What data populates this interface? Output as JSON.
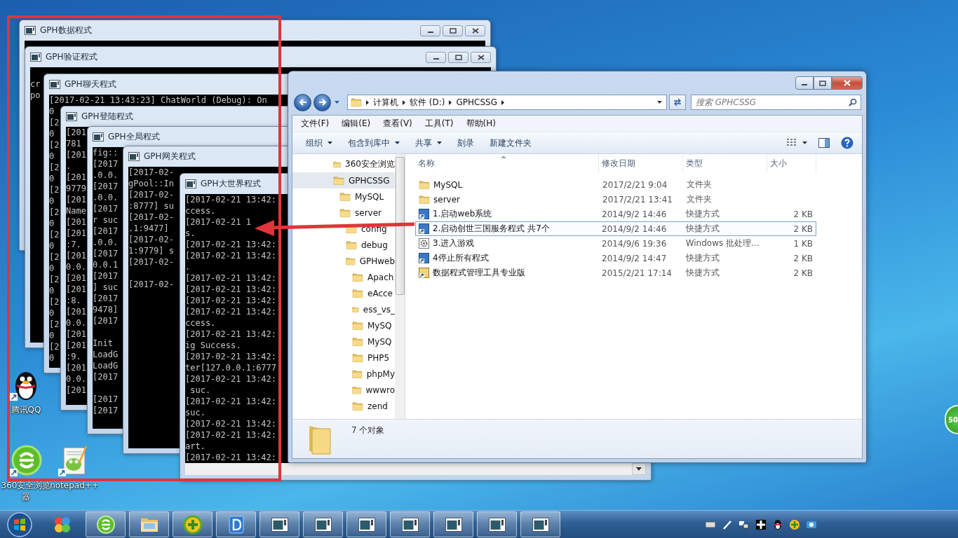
{
  "consoles": [
    {
      "title": "GPH数据程式"
    },
    {
      "title": "GPH验证程式",
      "blocks": [
        [
          "cr",
          "po"
        ]
      ]
    },
    {
      "title": "GPH聊天程式",
      "blocks": [
        [
          "[2017-02-21 13:43:23] ChatWorld (Debug): On",
          "0",
          "[2",
          "0",
          "[2",
          "0",
          "[2",
          "0",
          "[2",
          "0",
          "[2",
          "0",
          "[2",
          "0",
          "[2",
          "0",
          "[2",
          "0",
          "[2",
          "0",
          "[2",
          "0",
          "[2",
          "0"
        ]
      ]
    },
    {
      "title": "GPH登陆程式",
      "blocks": [
        [
          "[201",
          "781",
          "[201",
          ".",
          "[201",
          "9779",
          "[201",
          "Name",
          "[201",
          "[201",
          ":7.",
          "[201",
          "0.0.",
          "[201",
          "[201",
          ":8.",
          "[201",
          "0.0.",
          "[201",
          "[201",
          ":9.",
          "[201",
          "0.0.",
          "[201"
        ]
      ]
    },
    {
      "title": "GPH全局程式",
      "blocks": [
        [
          "fig::",
          "[2017",
          ".0.0.",
          "[2017",
          ".0.0.",
          "[2017",
          "r suc",
          "[2017",
          ".0.0.",
          "[2017",
          "0.0.1",
          "[2017",
          "] suc",
          "[2017",
          "9478]",
          "[2017"
        ],
        [
          "Init",
          "LoadG",
          "LoadG",
          "[2017"
        ],
        [
          "[2017",
          "[2017"
        ]
      ]
    },
    {
      "title": "GPH网关程式",
      "blocks": [
        [
          "[2017-02-",
          "gPool::In",
          "[2017-02-",
          ":8777] su",
          "[2017-02-",
          ".1:9477]",
          "[2017-02-",
          "1:9779] s",
          "[2017-02-"
        ],
        [
          "[2017-02-"
        ]
      ]
    },
    {
      "title": "GPH大世界程式",
      "blocks": [
        [
          "[2017-02-21 13:42:",
          "ccess.",
          "[2017-02-21 1",
          "s.",
          "[2017-02-21 13:42:",
          "[2017-02-21 13:42:",
          ".",
          "[2017-02-21 13:42:",
          "[2017-02-21 13:42:",
          "[2017-02-21 13:42:",
          "[2017-02-21 13:42:",
          "ccess.",
          "[2017-02-21 13:42:",
          "ig Success.",
          "[2017-02-21 13:42:",
          "ter[127.0.0.1:6777",
          "[2017-02-21 13:42:",
          " suc.",
          "[2017-02-21 13:42:",
          "suc.",
          "[2017-02-21 13:42:",
          "[2017-02-21 13:42:",
          "art.",
          "[2017-02-21 13:42:"
        ]
      ]
    }
  ],
  "explorer": {
    "breadcrumb": [
      "计算机",
      "软件 (D:)",
      "GPHCSSG"
    ],
    "search": {
      "placeholder": "搜索 GPHCSSG"
    },
    "menu": [
      "文件(F)",
      "编辑(E)",
      "查看(V)",
      "工具(T)",
      "帮助(H)"
    ],
    "toolbar": [
      {
        "label": "组织",
        "dropdown": true
      },
      {
        "label": "包含到库中",
        "dropdown": true
      },
      {
        "label": "共享",
        "dropdown": true
      },
      {
        "label": "刻录",
        "dropdown": false
      },
      {
        "label": "新建文件夹",
        "dropdown": false
      }
    ],
    "tree": [
      {
        "label": "360安全浏览",
        "selected": false
      },
      {
        "label": "GPHCSSG",
        "selected": true,
        "children": [
          {
            "label": "MySQL",
            "selected": false
          },
          {
            "label": "server",
            "selected": false,
            "children": [
              {
                "label": "config",
                "selected": false
              },
              {
                "label": "debug",
                "selected": false
              },
              {
                "label": "GPHweb",
                "selected": false,
                "children": [
                  {
                    "label": "Apach",
                    "selected": false
                  },
                  {
                    "label": "eAcce",
                    "selected": false
                  },
                  {
                    "label": "ess_vs_",
                    "selected": false
                  },
                  {
                    "label": "MySQ",
                    "selected": false
                  },
                  {
                    "label": "MySQ",
                    "selected": false
                  },
                  {
                    "label": "PHP5",
                    "selected": false
                  },
                  {
                    "label": "phpMy",
                    "selected": false
                  },
                  {
                    "label": "wwwro",
                    "selected": false
                  },
                  {
                    "label": "zend",
                    "selected": false
                  }
                ]
              }
            ]
          }
        ]
      }
    ],
    "columns": [
      "名称",
      "修改日期",
      "类型",
      "大小"
    ],
    "files": [
      {
        "kind": "folder",
        "name": "MySQL",
        "date": "2017/2/21 9:04",
        "type": "文件夹",
        "selected": false
      },
      {
        "kind": "folder",
        "name": "server",
        "date": "2017/2/21 13:41",
        "type": "文件夹",
        "selected": false
      },
      {
        "kind": "shortcut",
        "name": "1.启动web系统",
        "date": "2014/9/2 14:46",
        "type": "快捷方式",
        "size": "2 KB",
        "selected": false
      },
      {
        "kind": "shortcut",
        "name": "2.启动创世三国服务程式 共7个",
        "date": "2014/9/2 14:46",
        "type": "快捷方式",
        "size": "2 KB",
        "selected": true
      },
      {
        "kind": "batch",
        "name": "3.进入游戏",
        "date": "2014/9/6 19:36",
        "type": "Windows 批处理...",
        "size": "1 KB",
        "selected": false
      },
      {
        "kind": "shortcut",
        "name": "4停止所有程式",
        "date": "2014/9/2 14:47",
        "type": "快捷方式",
        "size": "2 KB",
        "selected": false
      },
      {
        "kind": "app",
        "name": "数据程式管理工具专业版",
        "date": "2015/2/21 17:14",
        "type": "快捷方式",
        "size": "2 KB",
        "selected": false
      }
    ],
    "status": "7 个对象"
  },
  "desktop_icons": [
    {
      "kind": "qq",
      "label": "腾讯QQ"
    },
    {
      "kind": "browser",
      "label": "360安全浏览器"
    },
    {
      "kind": "notepad",
      "label": "notepad++"
    }
  ],
  "side_widget": {
    "text": "50"
  }
}
